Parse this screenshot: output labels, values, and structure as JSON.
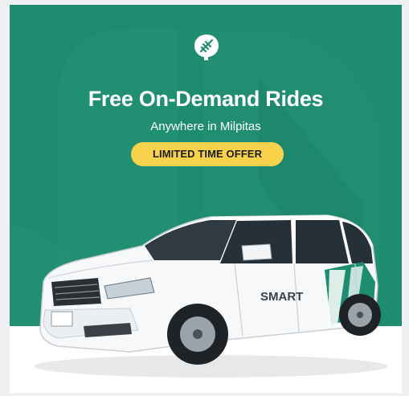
{
  "ad": {
    "headline": "Free On-Demand Rides",
    "subheadline": "Anywhere in Milpitas",
    "badge": "LIMITED TIME OFFER",
    "van_logo_text": "SMART"
  },
  "colors": {
    "brand_green": "#1d8c6f",
    "badge_yellow": "#f7d24a",
    "white": "#ffffff"
  },
  "icons": {
    "brand_logo": "leaf-icon"
  }
}
